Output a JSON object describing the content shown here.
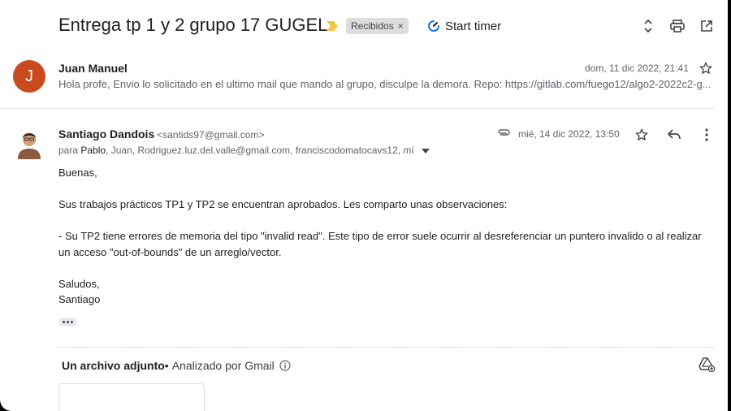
{
  "thread": {
    "subject": "Entrega tp 1 y 2 grupo 17 GUGEL",
    "label": "Recibidos",
    "label_remove": "×",
    "timer_label": "Start timer"
  },
  "message1": {
    "avatar_letter": "J",
    "avatar_color": "#c94a1f",
    "sender": "Juan Manuel",
    "date": "dom, 11 dic 2022, 21:41",
    "snippet": "Hola profe, Envio lo solicitado en el ultimo mail que mando al grupo, disculpe la demora. Repo: https://gitlab.com/fuego12/algo2-2022c2-g..."
  },
  "message2": {
    "sender": "Santiago Dandois",
    "email": "<santids97@gmail.com>",
    "date": "mié, 14 dic 2022, 13:50",
    "recipients_prefix": "para",
    "recipients_first": "Pablo",
    "recipients_rest": ", Juan, Rodriguez.luz.del.valle@gmail.com, franciscodomatocavs12, mí",
    "body": {
      "greeting": "Buenas,",
      "p1": "Sus trabajos prácticos TP1 y TP2 se encuentran aprobados. Les comparto unas observaciones:",
      "p2_line1": "- Su TP2 tiene errores de memoria del tipo \"invalid read\". Este tipo de error suele ocurrir al desreferenciar un puntero invalido o al realizar",
      "p2_line2": "un acceso \"out-of-bounds\" de un arreglo/vector.",
      "closing": "Saludos,",
      "signature": "Santiago"
    }
  },
  "attachments": {
    "title": "Un archivo adjunto",
    "separator": "•",
    "scan_status": "Analizado por Gmail"
  },
  "colors": {
    "importance": "#f4c542",
    "accent": "#1a73e8"
  }
}
